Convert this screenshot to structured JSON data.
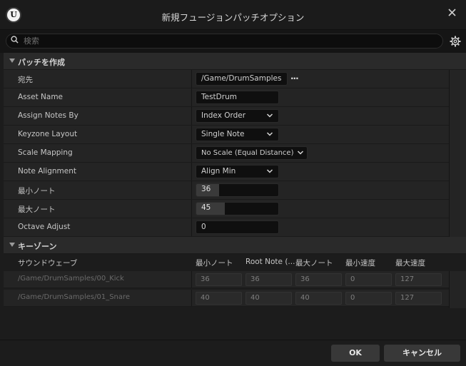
{
  "window": {
    "title": "新規フュージョンパッチオプション",
    "logo_text": "U"
  },
  "search": {
    "placeholder": "検索",
    "value": ""
  },
  "sections": {
    "create_patch": {
      "title": "パッチを作成",
      "rows": {
        "destination": {
          "label": "宛先",
          "value": "/Game/DrumSamples",
          "browse": "..."
        },
        "asset_name": {
          "label": "Asset Name",
          "value": "TestDrum"
        },
        "assign_notes_by": {
          "label": "Assign Notes By",
          "value": "Index Order"
        },
        "keyzone_layout": {
          "label": "Keyzone Layout",
          "value": "Single Note"
        },
        "scale_mapping": {
          "label": "Scale Mapping",
          "value": "No Scale (Equal Distance)"
        },
        "note_alignment": {
          "label": "Note Alignment",
          "value": "Align Min"
        },
        "min_note": {
          "label": "最小ノート",
          "value": "36",
          "level_fraction": 0.28
        },
        "max_note": {
          "label": "最大ノート",
          "value": "45",
          "level_fraction": 0.35
        },
        "octave_adjust": {
          "label": "Octave Adjust",
          "value": "0"
        }
      }
    },
    "keyzones": {
      "title": "キーゾーン",
      "columns": [
        "サウンドウェーブ",
        "最小ノート",
        "Root Note (...",
        "最大ノート",
        "最小速度",
        "最大速度"
      ],
      "rows": [
        {
          "wave": "/Game/DrumSamples/00_Kick",
          "min_note": "36",
          "root_note": "36",
          "max_note": "36",
          "min_velocity": "0",
          "max_velocity": "127"
        },
        {
          "wave": "/Game/DrumSamples/01_Snare",
          "min_note": "40",
          "root_note": "40",
          "max_note": "40",
          "min_velocity": "0",
          "max_velocity": "127"
        }
      ]
    }
  },
  "buttons": {
    "ok": "OK",
    "cancel": "キャンセル"
  },
  "colors": {
    "background": "#1c1c1c",
    "row": "#242424",
    "field": "#0f0f0f",
    "header": "#2a2a2a"
  }
}
